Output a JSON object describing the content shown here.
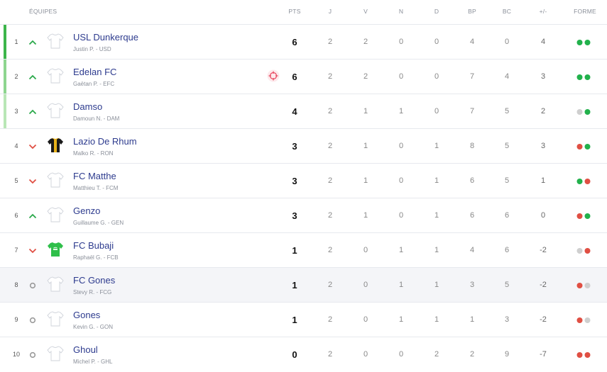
{
  "header": {
    "team": "ÉQUIPES",
    "pts": "PTS",
    "j": "J",
    "v": "V",
    "n": "N",
    "d": "D",
    "bp": "BP",
    "bc": "BC",
    "diff": "+/-",
    "form": "FORME"
  },
  "colors": {
    "win": "#22b14c",
    "loss": "#e04f43",
    "draw": "#cfcfcf",
    "up": "#2aa84a",
    "down": "#e04f43",
    "same": "#9a9a9a",
    "qualif_1": "#3cb54a",
    "qualif_2": "#8ed58f",
    "qualif_3": "#b9e6b6"
  },
  "rows": [
    {
      "rank": "1",
      "trend": "up",
      "jersey": "white-jersey",
      "name": "USL Dunkerque",
      "sub": "Justin P. - USD",
      "pts": "6",
      "j": "2",
      "v": "2",
      "n": "0",
      "d": "0",
      "bp": "4",
      "bc": "0",
      "diff": "4",
      "form": [
        "win",
        "win"
      ]
    },
    {
      "rank": "2",
      "trend": "up",
      "jersey": "white-jersey",
      "name": "Edelan FC",
      "sub": "Gaëtan P. - EFC",
      "pts": "6",
      "j": "2",
      "v": "2",
      "n": "0",
      "d": "0",
      "bp": "7",
      "bc": "4",
      "diff": "3",
      "form": [
        "win",
        "win"
      ],
      "icon": "target-icon"
    },
    {
      "rank": "3",
      "trend": "up",
      "jersey": "white-jersey",
      "name": "Damso",
      "sub": "Damoun N. - DAM",
      "pts": "4",
      "j": "2",
      "v": "1",
      "n": "1",
      "d": "0",
      "bp": "7",
      "bc": "5",
      "diff": "2",
      "form": [
        "draw",
        "win"
      ]
    },
    {
      "rank": "4",
      "trend": "down",
      "jersey": "striped-jersey",
      "name": "Lazio De Rhum",
      "sub": "Malko R. - RON",
      "pts": "3",
      "j": "2",
      "v": "1",
      "n": "0",
      "d": "1",
      "bp": "8",
      "bc": "5",
      "diff": "3",
      "form": [
        "loss",
        "win"
      ]
    },
    {
      "rank": "5",
      "trend": "down",
      "jersey": "white-jersey",
      "name": "FC Matthe",
      "sub": "Matthieu T. - FCM",
      "pts": "3",
      "j": "2",
      "v": "1",
      "n": "0",
      "d": "1",
      "bp": "6",
      "bc": "5",
      "diff": "1",
      "form": [
        "win",
        "loss"
      ]
    },
    {
      "rank": "6",
      "trend": "up",
      "jersey": "white-jersey",
      "name": "Genzo",
      "sub": "Guillaume G. - GEN",
      "pts": "3",
      "j": "2",
      "v": "1",
      "n": "0",
      "d": "1",
      "bp": "6",
      "bc": "6",
      "diff": "0",
      "form": [
        "loss",
        "win"
      ]
    },
    {
      "rank": "7",
      "trend": "down",
      "jersey": "green-jersey",
      "name": "FC Bubaji",
      "sub": "Raphaël G. - FCB",
      "pts": "1",
      "j": "2",
      "v": "0",
      "n": "1",
      "d": "1",
      "bp": "4",
      "bc": "6",
      "diff": "-2",
      "form": [
        "draw",
        "loss"
      ]
    },
    {
      "rank": "8",
      "trend": "same",
      "jersey": "white-jersey",
      "name": "FC Gones",
      "sub": "Stevy R. - FCG",
      "pts": "1",
      "j": "2",
      "v": "0",
      "n": "1",
      "d": "1",
      "bp": "3",
      "bc": "5",
      "diff": "-2",
      "form": [
        "loss",
        "draw"
      ],
      "highlight": true
    },
    {
      "rank": "9",
      "trend": "same",
      "jersey": "white-jersey",
      "name": "Gones",
      "sub": "Kevin G. - GON",
      "pts": "1",
      "j": "2",
      "v": "0",
      "n": "1",
      "d": "1",
      "bp": "1",
      "bc": "3",
      "diff": "-2",
      "form": [
        "loss",
        "draw"
      ]
    },
    {
      "rank": "10",
      "trend": "same",
      "jersey": "white-jersey",
      "name": "Ghoul",
      "sub": "Michel P. - GHL",
      "pts": "0",
      "j": "2",
      "v": "0",
      "n": "0",
      "d": "2",
      "bp": "2",
      "bc": "9",
      "diff": "-7",
      "form": [
        "loss",
        "loss"
      ]
    }
  ]
}
